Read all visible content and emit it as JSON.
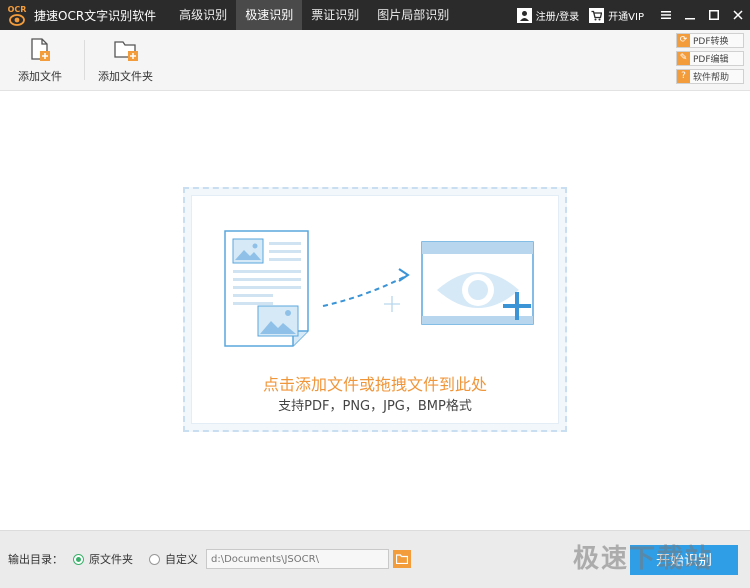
{
  "titlebar": {
    "logo_text": "OCR",
    "app_title": "捷速OCR文字识别软件",
    "tabs": [
      {
        "label": "高级识别"
      },
      {
        "label": "极速识别"
      },
      {
        "label": "票证识别"
      },
      {
        "label": "图片局部识别"
      }
    ],
    "active_tab": 1,
    "login_label": "注册/登录",
    "vip_label": "开通VIP"
  },
  "toolbar": {
    "add_file_label": "添加文件",
    "add_folder_label": "添加文件夹",
    "side_buttons": [
      {
        "label": "PDF转换"
      },
      {
        "label": "PDF编辑"
      },
      {
        "label": "软件帮助"
      }
    ]
  },
  "dropzone": {
    "title": "点击添加文件或拖拽文件到此处",
    "subtitle": "支持PDF，PNG，JPG，BMP格式"
  },
  "bottombar": {
    "output_label": "输出目录：",
    "option_original": "原文件夹",
    "option_custom": "自定义",
    "path_placeholder": "d:\\Documents\\JSOCR\\",
    "start_label": "开始识别"
  },
  "watermark": "极速下载站",
  "colors": {
    "titlebar_bg": "#2b2b2b",
    "accent_orange": "#f0963a",
    "accent_blue": "#2f9ee6",
    "radio_green": "#3bb06b"
  }
}
